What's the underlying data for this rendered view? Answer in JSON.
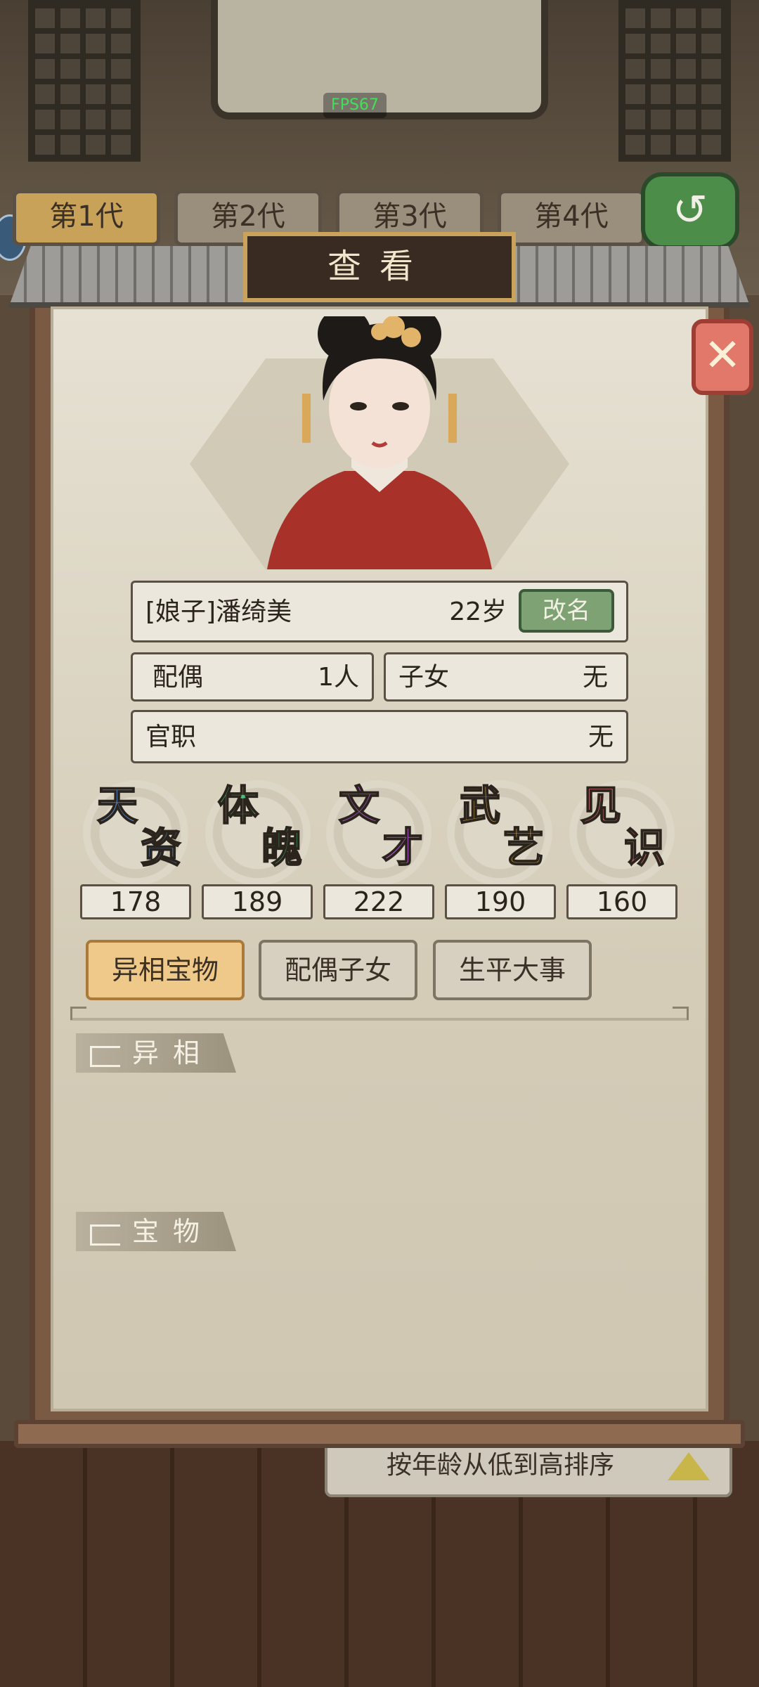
{
  "fps": "FPS67",
  "generation_tabs": [
    "第1代",
    "第2代",
    "第3代",
    "第4代"
  ],
  "dialog": {
    "title": "查看"
  },
  "profile": {
    "name": "[娘子]潘绮美",
    "age": "22岁",
    "rename_label": "改名",
    "spouse_label": "配偶",
    "spouse_value": "1人",
    "children_label": "子女",
    "children_value": "无",
    "office_label": "官职",
    "office_value": "无"
  },
  "stats": [
    {
      "c1": "天",
      "c2": "资",
      "value": "178",
      "color": "#5a9be8"
    },
    {
      "c1": "体",
      "c2": "魄",
      "value": "189",
      "color": "#45c27a"
    },
    {
      "c1": "文",
      "c2": "才",
      "value": "222",
      "color": "#b65ad8"
    },
    {
      "c1": "武",
      "c2": "艺",
      "value": "190",
      "color": "#e8b654"
    },
    {
      "c1": "见",
      "c2": "识",
      "value": "160",
      "color": "#e6787a"
    }
  ],
  "tabs": [
    "异相宝物",
    "配偶子女",
    "生平大事"
  ],
  "sections": {
    "traits": "异相",
    "treasures": "宝物"
  },
  "sort_label": "按年龄从低到高排序"
}
